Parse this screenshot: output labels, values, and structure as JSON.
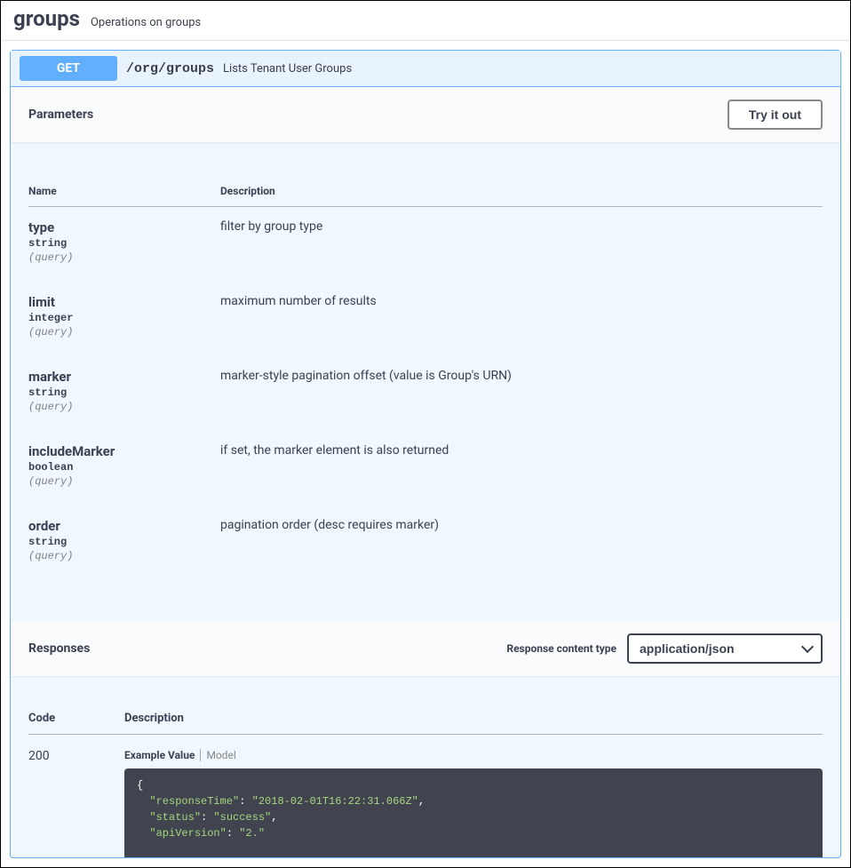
{
  "tag": {
    "name": "groups",
    "description": "Operations on groups"
  },
  "operation": {
    "method": "GET",
    "path": "/org/groups",
    "summary": "Lists Tenant User Groups"
  },
  "parameters_section": {
    "title": "Parameters",
    "try_button": "Try it out",
    "columns": {
      "name": "Name",
      "description": "Description"
    },
    "items": [
      {
        "name": "type",
        "type": "string",
        "in": "(query)",
        "description": "filter by group type"
      },
      {
        "name": "limit",
        "type": "integer",
        "in": "(query)",
        "description": "maximum number of results"
      },
      {
        "name": "marker",
        "type": "string",
        "in": "(query)",
        "description": "marker-style pagination offset (value is Group's URN)"
      },
      {
        "name": "includeMarker",
        "type": "boolean",
        "in": "(query)",
        "description": "if set, the marker element is also returned"
      },
      {
        "name": "order",
        "type": "string",
        "in": "(query)",
        "description": "pagination order (desc requires marker)"
      }
    ]
  },
  "responses_section": {
    "title": "Responses",
    "content_type_label": "Response content type",
    "content_type_value": "application/json",
    "columns": {
      "code": "Code",
      "description": "Description"
    },
    "items": [
      {
        "code": "200",
        "tabs": {
          "active": "Example Value",
          "inactive": "Model"
        },
        "example_lines": [
          "{",
          "  \"responseTime\": \"2018-02-01T16:22:31.066Z\",",
          "  \"status\": \"success\",",
          "  \"apiVersion\": \"2.\""
        ]
      }
    ]
  }
}
